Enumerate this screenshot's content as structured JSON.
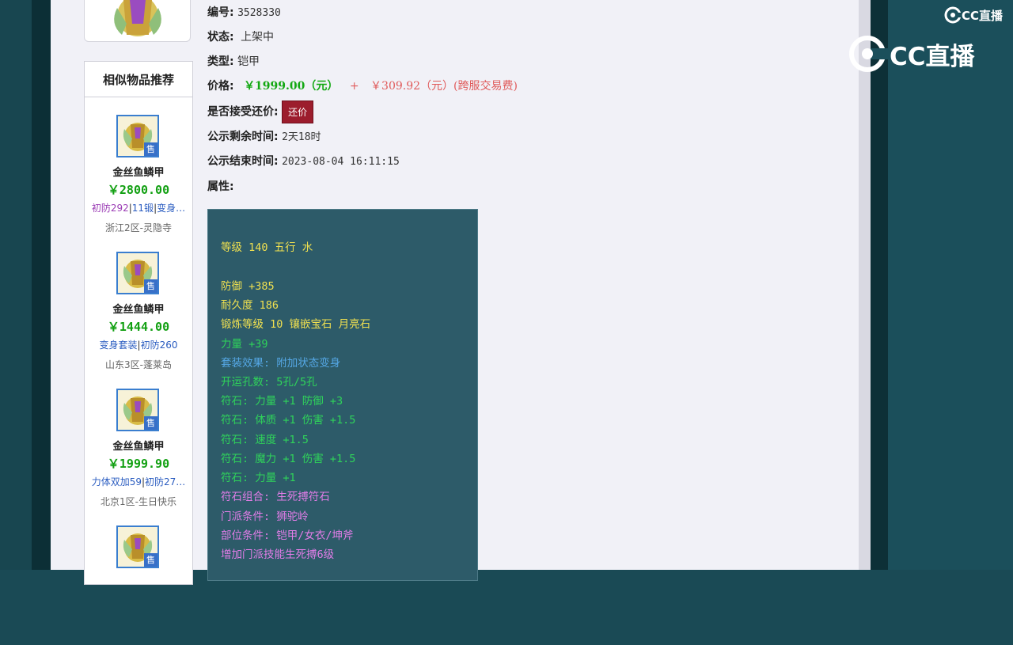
{
  "item": {
    "id_label": "编号:",
    "id_value": "3528330",
    "status_label": "状态:",
    "status_value": "上架中",
    "type_label": "类型:",
    "type_value": "铠甲",
    "price_label": "价格:",
    "price_value": "￥1999.00（元）",
    "price_plus": "+",
    "fee_value": "￥309.92（元）(跨服交易费)",
    "bargain_label": "是否接受还价:",
    "bargain_button": "还价",
    "remaining_label": "公示剩余时间:",
    "remaining_value": "2天18时",
    "end_label": "公示结束时间:",
    "end_value": "2023-08-04 16:11:15",
    "attr_label": "属性:"
  },
  "attributes": [
    {
      "text": "等级 140 五行 水",
      "color": "#f0e050"
    },
    {
      "text": "防御 +385",
      "color": "#f0e050"
    },
    {
      "text": "耐久度 186",
      "color": "#f0e050"
    },
    {
      "text": "锻炼等级 10 镶嵌宝石 月亮石",
      "color": "#f0e050"
    },
    {
      "text": "力量 +39",
      "color": "#2fd45a"
    },
    {
      "text": "套装效果: 附加状态变身",
      "color": "#55a8e6"
    },
    {
      "text": "开运孔数: 5孔/5孔",
      "color": "#2fd45a"
    },
    {
      "text": "符石: 力量 +1 防御 +3",
      "color": "#2fd45a"
    },
    {
      "text": "符石: 体质 +1 伤害 +1.5",
      "color": "#2fd45a"
    },
    {
      "text": "符石: 速度 +1.5",
      "color": "#2fd45a"
    },
    {
      "text": "符石: 魔力 +1 伤害 +1.5",
      "color": "#2fd45a"
    },
    {
      "text": "符石: 力量 +1",
      "color": "#2fd45a"
    },
    {
      "text": "符石组合: 生死搏符石",
      "color": "#e27de8"
    },
    {
      "text": "门派条件: 狮驼岭",
      "color": "#e27de8"
    },
    {
      "text": "部位条件: 铠甲/女衣/坤斧",
      "color": "#e27de8"
    },
    {
      "text": "增加门派技能生死搏6级",
      "color": "#e27de8"
    }
  ],
  "sidebar": {
    "title": "相似物品推荐",
    "sale_tag": "售",
    "items": [
      {
        "name": "金丝鱼鳞甲",
        "price": "￥2800.00",
        "tag1": "初防292",
        "tag2": "11锻",
        "tag3": "变身…",
        "server": "浙江2区-灵隐寺"
      },
      {
        "name": "金丝鱼鳞甲",
        "price": "￥1444.00",
        "tag1": "变身套装",
        "tag2": "初防260",
        "tag3": "",
        "server": "山东3区-蓬莱岛"
      },
      {
        "name": "金丝鱼鳞甲",
        "price": "￥1999.90",
        "tag1": "力体双加59",
        "tag2": "初防27…",
        "tag3": "",
        "server": "北京1区-生日快乐"
      }
    ]
  },
  "watermark": {
    "small": "CC直播",
    "big": "CC直播"
  },
  "colors": {
    "price_green": "#13a813",
    "price_red": "#e05a5a",
    "button_red": "#9c1d2d",
    "attr_bg": "#2d5b69"
  }
}
